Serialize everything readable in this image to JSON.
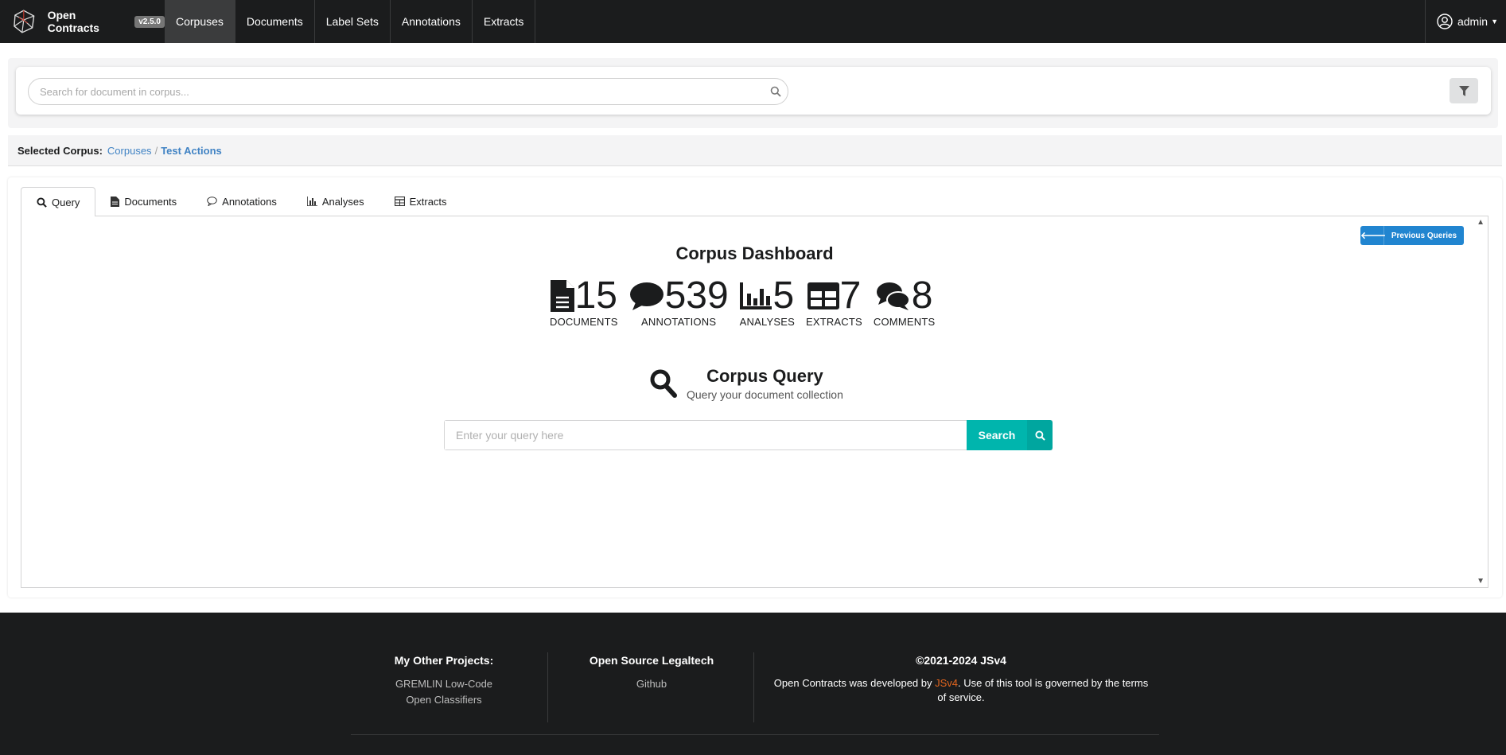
{
  "navbar": {
    "app_name": "Open Contracts",
    "version": "v2.5.0",
    "items": [
      {
        "label": "Corpuses",
        "active": true
      },
      {
        "label": "Documents",
        "active": false
      },
      {
        "label": "Label Sets",
        "active": false
      },
      {
        "label": "Annotations",
        "active": false
      },
      {
        "label": "Extracts",
        "active": false
      }
    ],
    "user": "admin"
  },
  "search": {
    "placeholder": "Search for document in corpus..."
  },
  "breadcrumb": {
    "label": "Selected Corpus:",
    "root": "Corpuses",
    "separator": "/",
    "current": "Test Actions"
  },
  "tabs": [
    {
      "label": "Query",
      "icon": "search-icon",
      "active": true
    },
    {
      "label": "Documents",
      "icon": "file-icon",
      "active": false
    },
    {
      "label": "Annotations",
      "icon": "comment-icon",
      "active": false
    },
    {
      "label": "Analyses",
      "icon": "bar-chart-icon",
      "active": false
    },
    {
      "label": "Extracts",
      "icon": "table-icon",
      "active": false
    }
  ],
  "dashboard": {
    "previous_queries_label": "Previous Queries",
    "title": "Corpus Dashboard",
    "stats": {
      "documents": {
        "value": "15",
        "label": "DOCUMENTS"
      },
      "annotations": {
        "value": "539",
        "label": "ANNOTATIONS"
      },
      "analyses": {
        "value": "5",
        "label": "ANALYSES"
      },
      "extracts": {
        "value": "7",
        "label": "EXTRACTS"
      },
      "comments": {
        "value": "8",
        "label": "COMMENTS"
      }
    }
  },
  "query": {
    "title": "Corpus Query",
    "subtitle": "Query your document collection",
    "placeholder": "Enter your query here",
    "button_label": "Search"
  },
  "footer": {
    "projects_heading": "My Other Projects:",
    "projects": [
      "GREMLIN Low-Code",
      "Open Classifiers"
    ],
    "legaltech_heading": "Open Source Legaltech",
    "legaltech_links": [
      "Github"
    ],
    "copyright": "©2021-2024 JSv4",
    "text_before": "Open Contracts was developed by ",
    "text_link": "JSv4",
    "text_after": ". Use of this tool is governed by the terms of service."
  },
  "colors": {
    "navbar_bg": "#1b1c1d",
    "primary_blue": "#2185d0",
    "teal": "#00b5ad",
    "link_blue": "#4183c4",
    "accent_orange": "#e2651e"
  }
}
